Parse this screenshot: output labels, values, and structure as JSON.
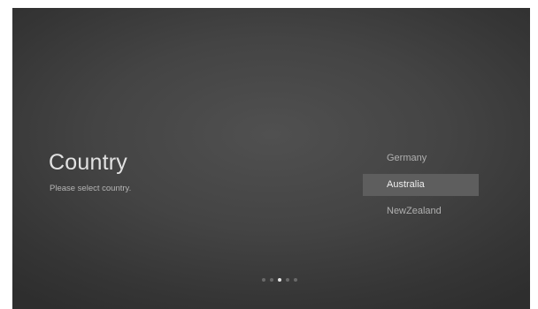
{
  "screen": {
    "title": "Country",
    "subtitle": "Please select country."
  },
  "country_list": {
    "selected_index": 1,
    "items": [
      {
        "label": "Germany"
      },
      {
        "label": "Australia"
      },
      {
        "label": "NewZealand"
      }
    ]
  },
  "pager": {
    "total_pages": 5,
    "current_page": 3
  },
  "colors": {
    "background": "#444444",
    "selection_highlight": "#5e5e5e",
    "text_primary": "#e2e2e2",
    "text_secondary": "#b0b0b0"
  }
}
